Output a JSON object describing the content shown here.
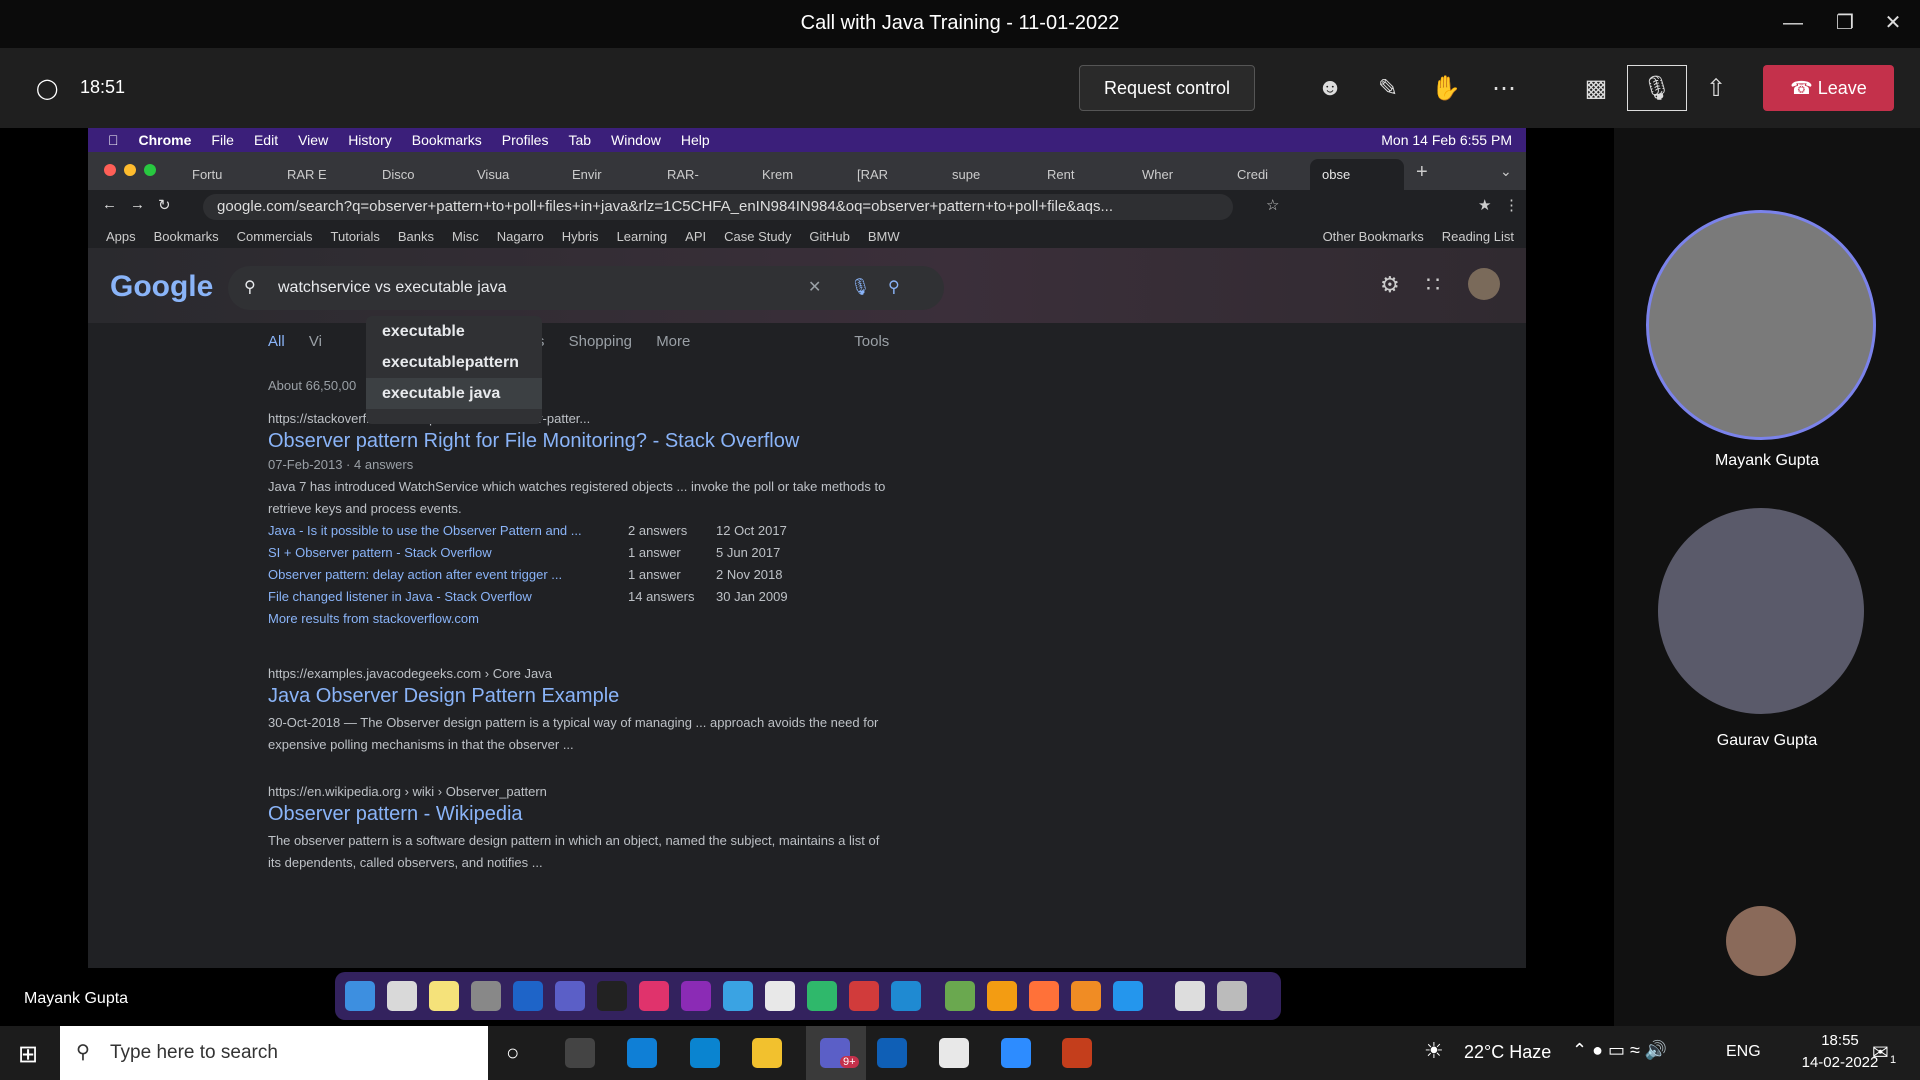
{
  "window": {
    "title": "Call with Java Training - 11-01-2022"
  },
  "meeting": {
    "time": "18:51",
    "request_control": "Request control",
    "leave": "Leave",
    "presenter": "Mayank Gupta"
  },
  "mac": {
    "app": "Chrome",
    "menu": [
      "File",
      "Edit",
      "View",
      "History",
      "Bookmarks",
      "Profiles",
      "Tab",
      "Window",
      "Help"
    ],
    "datetime": "Mon 14 Feb 6:55 PM"
  },
  "tabs": [
    "Fortu",
    "RAR E",
    "Disco",
    "Visua",
    "Envir",
    "RAR-",
    "Krem",
    "[RAR",
    "supe",
    "Rent",
    "Wher",
    "Credi",
    "obse"
  ],
  "url": "google.com/search?q=observer+pattern+to+poll+files+in+java&rlz=1C5CHFA_enIN984IN984&oq=observer+pattern+to+poll+file&aqs...",
  "bookmarks": [
    "Apps",
    "Bookmarks",
    "Commercials",
    "Tutorials",
    "Banks",
    "Misc",
    "Nagarro",
    "Hybris",
    "Learning",
    "API",
    "Case Study",
    "GitHub",
    "BMW",
    "Other Bookmarks",
    "Reading List"
  ],
  "google": {
    "query": "watchservice vs executable java",
    "suggestions": [
      "executable",
      "executablepattern",
      "executable java"
    ],
    "tabs": [
      "All",
      "Vi",
      "ws",
      "Shopping",
      "More",
      "Tools"
    ],
    "stats": "About 66,50,00",
    "results": [
      {
        "url": "https://stackoverflow.com › questions › observer-patter...",
        "title": "Observer pattern Right for File Monitoring? - Stack Overflow",
        "meta": "07-Feb-2013 · 4 answers",
        "snippet": "Java 7 has introduced WatchService which watches registered objects ... invoke the poll or take methods to retrieve keys and process events.",
        "sub": [
          [
            "Java - Is it possible to use the Observer Pattern and ...",
            "2 answers",
            "12 Oct 2017"
          ],
          [
            "SI + Observer pattern - Stack Overflow",
            "1 answer",
            "5 Jun 2017"
          ],
          [
            "Observer pattern: delay action after event trigger ...",
            "1 answer",
            "2 Nov 2018"
          ],
          [
            "File changed listener in Java - Stack Overflow",
            "14 answers",
            "30 Jan 2009"
          ]
        ],
        "more": "More results from stackoverflow.com"
      },
      {
        "url": "https://examples.javacodegeeks.com › Core Java",
        "title": "Java Observer Design Pattern Example",
        "snippet": "30-Oct-2018 — The Observer design pattern is a typical way of managing ... approach avoids the need for expensive polling mechanisms in that the observer ..."
      },
      {
        "url": "https://en.wikipedia.org › wiki › Observer_pattern",
        "title": "Observer pattern - Wikipedia",
        "snippet": "The observer pattern is a software design pattern in which an object, named the subject, maintains a list of its dependents, called observers, and notifies ..."
      }
    ]
  },
  "participants": [
    "Mayank Gupta",
    "Gaurav Gupta"
  ],
  "taskbar": {
    "search_placeholder": "Type here to search",
    "weather": "22°C  Haze",
    "lang": "ENG",
    "time": "18:55",
    "date": "14-02-2022",
    "badge": "9+",
    "notif": "1"
  }
}
